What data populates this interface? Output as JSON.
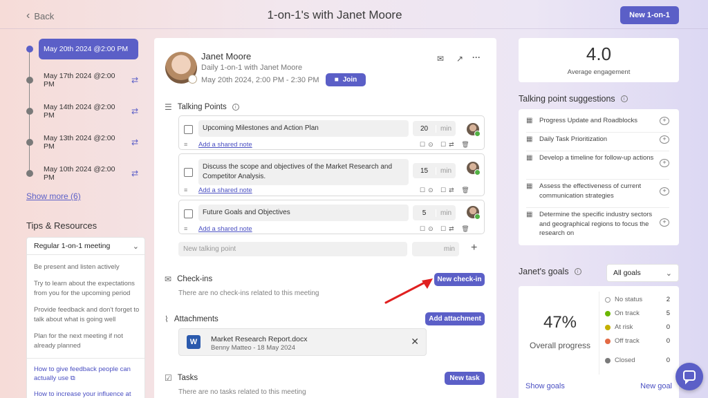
{
  "header": {
    "back_label": "Back",
    "title": "1-on-1's with Janet Moore",
    "new_button": "New 1-on-1"
  },
  "timeline": {
    "items": [
      {
        "label": "May 20th 2024 @2:00 PM",
        "active": true,
        "recurring": false
      },
      {
        "label": "May 17th 2024 @2:00 PM",
        "active": false,
        "recurring": true
      },
      {
        "label": "May 14th 2024 @2:00 PM",
        "active": false,
        "recurring": true
      },
      {
        "label": "May 13th 2024 @2:00 PM",
        "active": false,
        "recurring": true
      },
      {
        "label": "May 10th 2024 @2:00 PM",
        "active": false,
        "recurring": true
      }
    ],
    "show_more": "Show more (6)"
  },
  "tips": {
    "title": "Tips & Resources",
    "select_value": "Regular 1-on-1 meeting",
    "items": [
      "Be present and listen actively",
      "Try to learn about the expectations from you for the upcoming period",
      "Provide feedback and don't forget to talk about what is going well",
      "Plan for the next meeting if not already planned"
    ],
    "links": [
      "How to give feedback people can actually use",
      "How to increase your influence at"
    ]
  },
  "meeting": {
    "name": "Janet Moore",
    "subtitle": "Daily 1-on-1 with Janet Moore",
    "datetime": "May 20th 2024, 2:00 PM - 2:30 PM",
    "join_label": "Join"
  },
  "talking_points": {
    "title": "Talking Points",
    "items": [
      {
        "text": "Upcoming Milestones and Action Plan",
        "minutes": "20",
        "unit": "min",
        "note": "Add a shared note"
      },
      {
        "text": "Discuss the scope and objectives of the Market Research and Competitor Analysis.",
        "minutes": "15",
        "unit": "min",
        "note": "Add a shared note"
      },
      {
        "text": "Future Goals and Objectives",
        "minutes": "5",
        "unit": "min",
        "note": "Add a shared note"
      }
    ],
    "new_placeholder": "New talking point",
    "new_min_placeholder": "min"
  },
  "checkins": {
    "title": "Check-ins",
    "empty": "There are no check-ins related to this meeting",
    "button": "New check-in"
  },
  "attachments": {
    "title": "Attachments",
    "button": "Add attachment",
    "file_name": "Market Research Report.docx",
    "file_meta": "Benny Matteo - 18 May 2024",
    "file_icon_letter": "W"
  },
  "tasks": {
    "title": "Tasks",
    "button": "New task",
    "empty": "There are no tasks related to this meeting"
  },
  "engagement": {
    "value": "4.0",
    "label": "Average engagement"
  },
  "suggestions": {
    "title": "Talking point suggestions",
    "items": [
      "Progress Update and Roadblocks",
      "Daily Task Prioritization",
      "Develop a timeline for follow-up actions",
      "Assess the effectiveness of current communication strategies",
      "Determine the specific industry sectors and geographical regions to focus the research on"
    ]
  },
  "goals": {
    "title": "Janet's goals",
    "filter": "All goals",
    "percent": "47%",
    "percent_label": "Overall progress",
    "stats": [
      {
        "label": "No status",
        "count": "2",
        "color": "#ffffff"
      },
      {
        "label": "On track",
        "count": "5",
        "color": "#6bb700"
      },
      {
        "label": "At risk",
        "count": "0",
        "color": "#c4b000"
      },
      {
        "label": "Off track",
        "count": "0",
        "color": "#e36a44"
      },
      {
        "label": "Closed",
        "count": "0",
        "color": "#7a7a7a"
      }
    ],
    "show_goals": "Show goals",
    "new_goal": "New goal"
  },
  "colors": {
    "accent": "#5b5fc7",
    "annotation_arrow": "#e02020"
  }
}
